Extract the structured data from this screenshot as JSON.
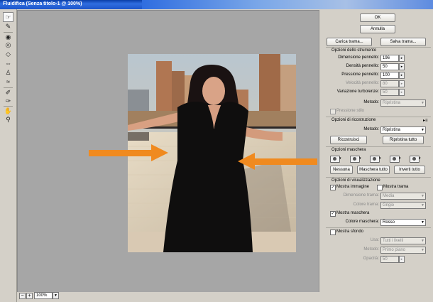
{
  "window": {
    "title": "Fluidifica (Senza titolo-1 @ 100%)"
  },
  "tools": [
    "warp-forward-icon",
    "reconstruct-icon",
    "twirl-icon",
    "pucker-icon",
    "bloat-icon",
    "push-left-icon",
    "mirror-icon",
    "turbulence-icon",
    "freeze-mask-icon",
    "thaw-mask-icon",
    "hand-icon",
    "zoom-icon"
  ],
  "dialog": {
    "ok": "OK",
    "cancel": "Annulla",
    "load_mesh": "Carica trama...",
    "save_mesh": "Salva trama..."
  },
  "tool_options": {
    "header": "Opzioni dello strumento",
    "brush_size": {
      "label": "Dimensione pennello:",
      "value": "196"
    },
    "brush_density": {
      "label": "Densità pennello:",
      "value": "50"
    },
    "brush_pressure": {
      "label": "Pressione pennello:",
      "value": "100"
    },
    "brush_rate": {
      "label": "Velocità pennello:",
      "value": "80"
    },
    "turbulent_jitter": {
      "label": "Variazione turbolenze:",
      "value": "50"
    },
    "mode": {
      "label": "Metodo:",
      "value": "Ripristina"
    },
    "stylus_pressure": "Pressione stilo"
  },
  "reconstruct": {
    "header": "Opzioni di ricostruzione",
    "mode_label": "Metodo:",
    "mode_value": "Ripristina",
    "reconstruct_btn": "Ricostruisci",
    "restore_all_btn": "Ripristina tutto"
  },
  "mask": {
    "header": "Opzioni maschera",
    "none_btn": "Nessuna",
    "mask_all_btn": "Maschera tutto",
    "invert_all_btn": "Inverti tutto"
  },
  "view": {
    "header": "Opzioni di visualizzazione",
    "show_image": "Mostra immagine",
    "show_mesh": "Mostra trama",
    "mesh_size": {
      "label": "Dimensione trama:",
      "value": "Media"
    },
    "mesh_color": {
      "label": "Colore trama:",
      "value": "Grigio"
    },
    "show_mask": "Mostra maschera",
    "mask_color": {
      "label": "Colore maschera:",
      "value": "Rosso"
    },
    "show_backdrop": "Mostra sfondo",
    "use": {
      "label": "Usa:",
      "value": "Tutti i livelli"
    },
    "backdrop_mode": {
      "label": "Metodo:",
      "value": "Primo piano"
    },
    "opacity": {
      "label": "Opacità:",
      "value": "50"
    }
  },
  "status": {
    "zoom": "100%"
  },
  "colors": {
    "arrow": "#f08a1f",
    "title_bar": "#1c55c9",
    "dress": "#0f0e0e"
  }
}
